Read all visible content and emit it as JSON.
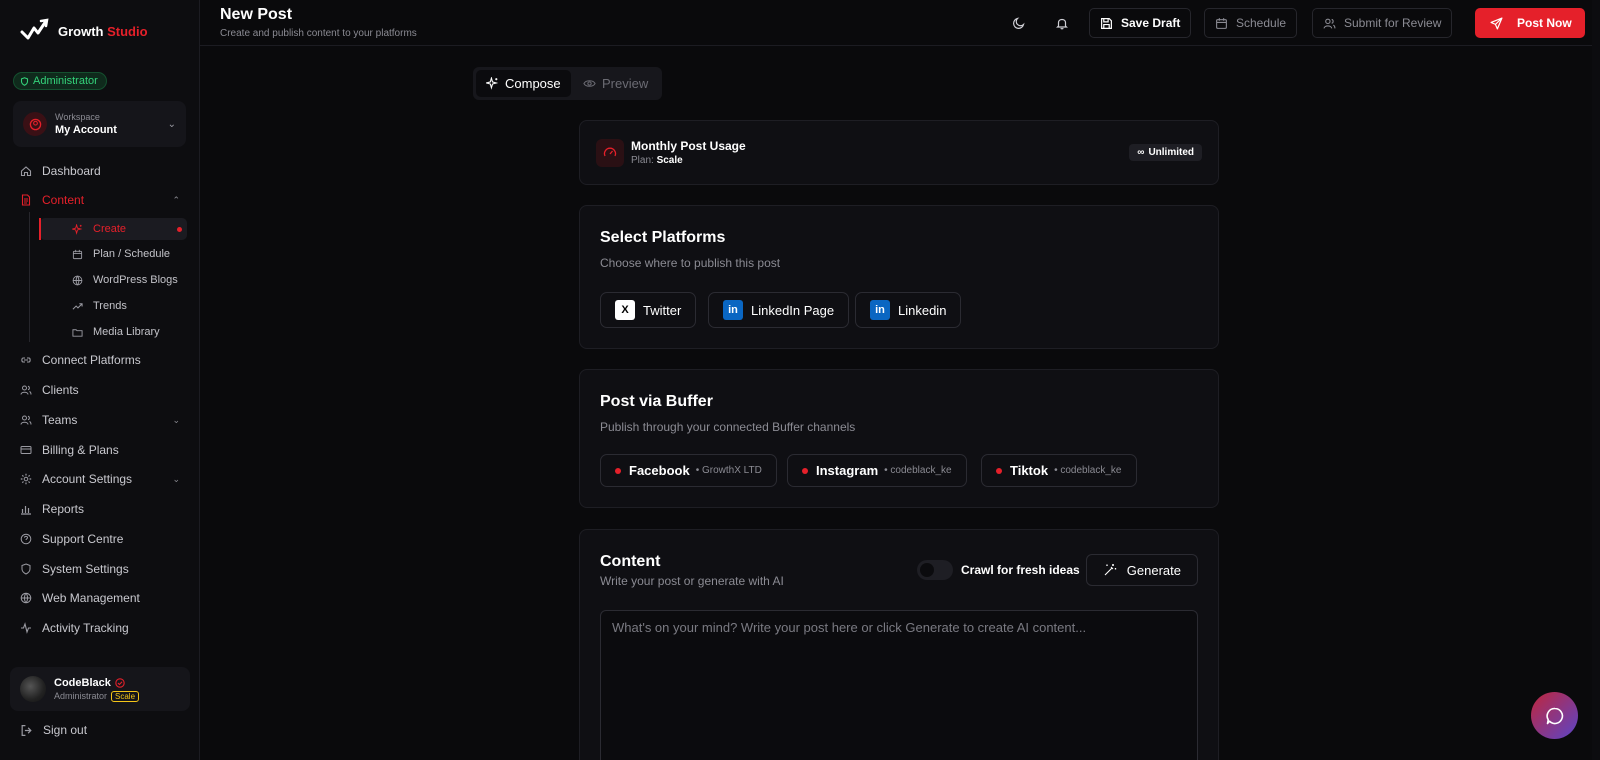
{
  "brand": {
    "name_plain": "Growth ",
    "name_accent": "Studio",
    "mark_caption": "Growth Studio"
  },
  "sidebar": {
    "role_badge": "Administrator",
    "workspace": {
      "label": "Workspace",
      "name": "My Account"
    },
    "nav": [
      {
        "label": "Dashboard",
        "icon": "home-icon"
      },
      {
        "label": "Content",
        "icon": "document-icon",
        "active": true,
        "expanded": true
      },
      {
        "label": "Connect Platforms",
        "icon": "link-icon"
      },
      {
        "label": "Clients",
        "icon": "users-icon"
      },
      {
        "label": "Teams",
        "icon": "team-icon"
      },
      {
        "label": "Billing & Plans",
        "icon": "card-icon"
      },
      {
        "label": "Account Settings",
        "icon": "gear-icon"
      },
      {
        "label": "Reports",
        "icon": "bar-chart-icon"
      },
      {
        "label": "Support Centre",
        "icon": "help-icon"
      },
      {
        "label": "System Settings",
        "icon": "shield-icon"
      },
      {
        "label": "Web Management",
        "icon": "globe-icon"
      },
      {
        "label": "Activity Tracking",
        "icon": "activity-icon"
      }
    ],
    "content_sub": [
      {
        "label": "Create",
        "icon": "sparkle-icon",
        "active": true
      },
      {
        "label": "Plan / Schedule",
        "icon": "calendar-icon"
      },
      {
        "label": "WordPress Blogs",
        "icon": "globe-icon"
      },
      {
        "label": "Trends",
        "icon": "trend-icon"
      },
      {
        "label": "Media Library",
        "icon": "folder-icon"
      }
    ],
    "user": {
      "name": "CodeBlack",
      "role": "Administrator",
      "plan": "Scale"
    },
    "signout": "Sign out"
  },
  "header": {
    "title": "New Post",
    "subtitle": "Create and publish content to your platforms",
    "save_draft": "Save Draft",
    "schedule": "Schedule",
    "submit_review": "Submit for Review",
    "post_now": "Post Now"
  },
  "tabs": {
    "compose": "Compose",
    "preview": "Preview"
  },
  "usage": {
    "title": "Monthly Post Usage",
    "plan_label": "Plan:",
    "plan_value": "Scale",
    "limit_symbol": "∞",
    "limit": "Unlimited"
  },
  "platforms": {
    "title": "Select Platforms",
    "subtitle": "Choose where to publish this post",
    "items": [
      {
        "label": "Twitter",
        "logo": "X"
      },
      {
        "label": "LinkedIn Page",
        "logo": "in"
      },
      {
        "label": "Linkedin",
        "logo": "in"
      }
    ]
  },
  "buffer": {
    "title": "Post via Buffer",
    "subtitle": "Publish through your connected Buffer channels",
    "channels": [
      {
        "name": "Facebook",
        "account": "• GrowthX LTD"
      },
      {
        "name": "Instagram",
        "account": "• codeblack_ke"
      },
      {
        "name": "Tiktok",
        "account": "• codeblack_ke"
      }
    ]
  },
  "content": {
    "title": "Content",
    "subtitle": "Write your post or generate with AI",
    "crawl_label": "Crawl for fresh ideas",
    "generate": "Generate",
    "placeholder": "What's on your mind? Write your post here or click Generate to create AI content..."
  },
  "colors": {
    "accent": "#e5202a",
    "success": "#34d27a",
    "background": "#0a0a0c"
  }
}
